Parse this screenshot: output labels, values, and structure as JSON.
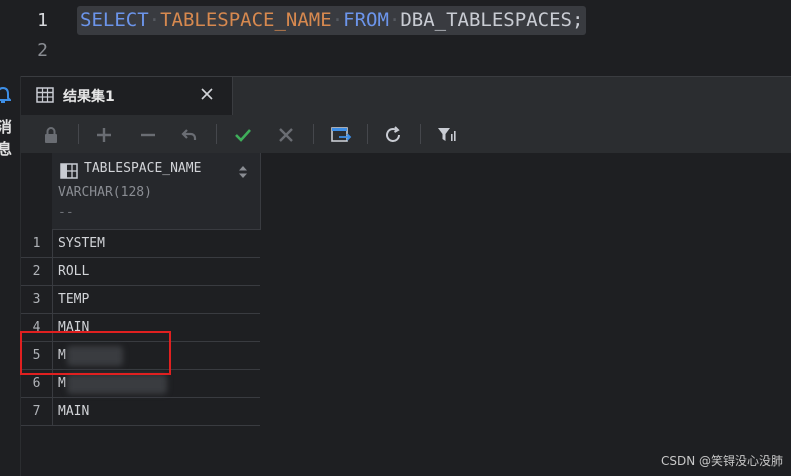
{
  "editor": {
    "line_numbers": [
      "1",
      "2"
    ],
    "sql": {
      "kw_select": "SELECT",
      "column": "TABLESPACE_NAME",
      "kw_from": "FROM",
      "table": "DBA_TABLESPACES;"
    }
  },
  "side_panel": {
    "label": "消息"
  },
  "results_tab": {
    "label": "结果集1"
  },
  "toolbar": {
    "icons": [
      "lock-icon",
      "plus-icon",
      "minus-icon",
      "undo-icon",
      "check-icon",
      "cancel-icon",
      "export-icon",
      "refresh-icon",
      "filter-icon"
    ]
  },
  "grid": {
    "column": {
      "name": "TABLESPACE_NAME",
      "type": "VARCHAR(128)",
      "null_marker": "--"
    },
    "rows": [
      {
        "num": "1",
        "value": "SYSTEM"
      },
      {
        "num": "2",
        "value": "ROLL"
      },
      {
        "num": "3",
        "value": "TEMP"
      },
      {
        "num": "4",
        "value": "MAIN"
      },
      {
        "num": "5",
        "value": "M"
      },
      {
        "num": "6",
        "value": "M"
      },
      {
        "num": "7",
        "value": "MAIN"
      }
    ]
  },
  "watermark": "CSDN @笑锝没心没肺",
  "colors": {
    "accent_keyword": "#6c95eb",
    "identifier": "#d7894f",
    "highlight_box": "#e02020",
    "check": "#3fae5a"
  }
}
